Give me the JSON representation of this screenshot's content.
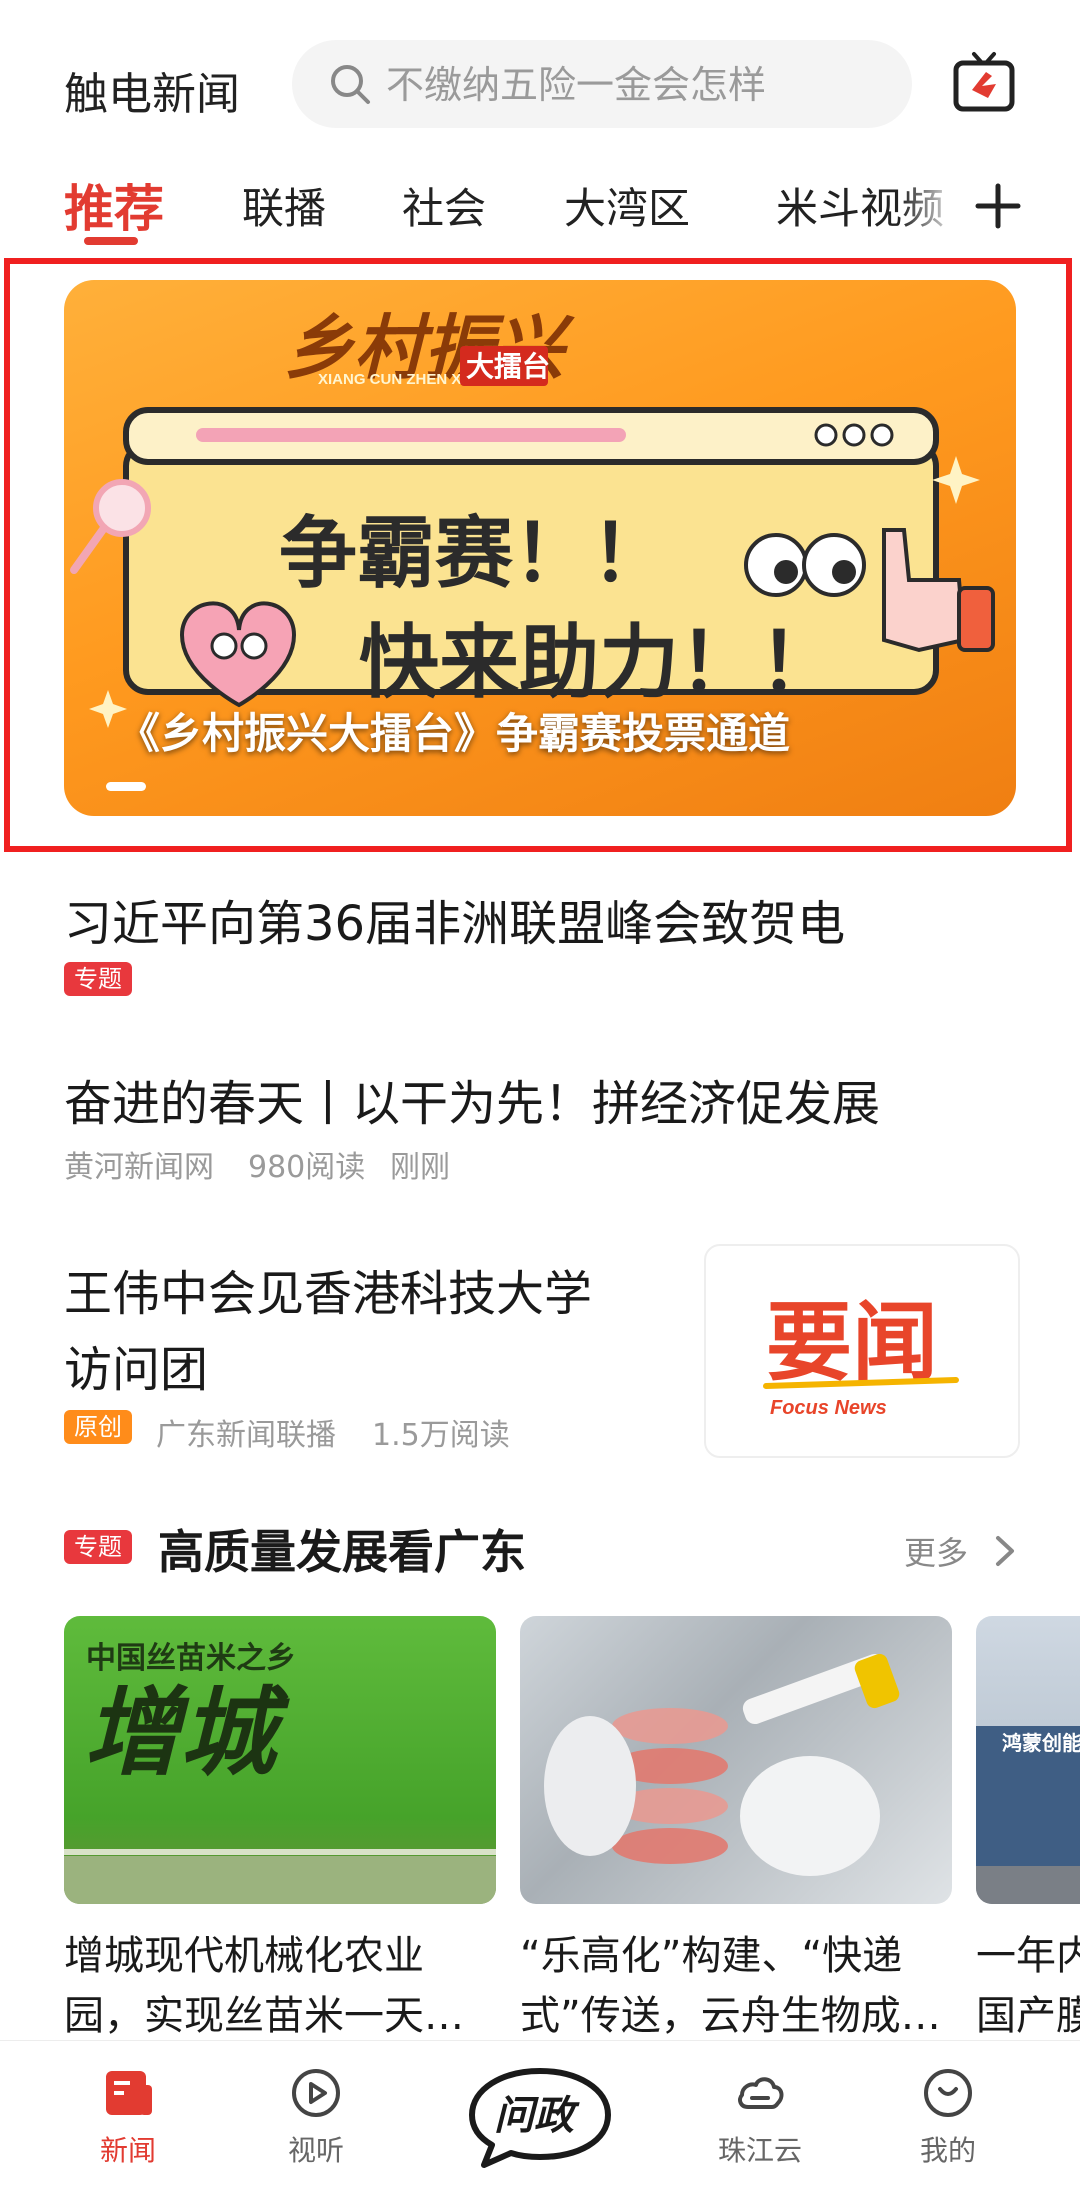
{
  "header": {
    "app_title": "触电新闻",
    "search_placeholder": "不缴纳五险一金会怎样"
  },
  "tabs": [
    {
      "label": "推荐",
      "active": true
    },
    {
      "label": "联播",
      "active": false
    },
    {
      "label": "社会",
      "active": false
    },
    {
      "label": "大湾区",
      "active": false
    },
    {
      "label": "米斗视频",
      "active": false
    }
  ],
  "banner": {
    "brand_title": "乡村振兴",
    "brand_pinyin": "XIANG CUN ZHEN XING",
    "brand_tag": "大擂台",
    "line1": "争霸赛！！",
    "line2": "快来助力！！",
    "caption": "《乡村振兴大擂台》争霸赛投票通道"
  },
  "feed": [
    {
      "title": "习近平向第36届非洲联盟峰会致贺电",
      "badge": "专题"
    },
    {
      "title": "奋进的春天丨以干为先！拼经济促发展",
      "source": "黄河新闻网",
      "reads": "980阅读",
      "time": "刚刚"
    },
    {
      "title_line1": "王伟中会见香港科技大学",
      "title_line2": "访问团",
      "badge": "原创",
      "source": "广东新闻联播",
      "reads": "1.5万阅读",
      "thumb_text": "要闻",
      "thumb_sub": "Focus News"
    }
  ],
  "topic": {
    "badge": "专题",
    "title": "高质量发展看广东",
    "more": "更多",
    "cards": [
      {
        "line1": "增城现代机械化农业",
        "line2": "园，实现丝苗米一天…",
        "image_text_top": "中国丝苗米之乡",
        "image_text_main": "增城"
      },
      {
        "line1": "“乐高化”构建、“快递",
        "line2": "式”传送，云舟生物成…"
      },
      {
        "line1": "一年内",
        "line2": "国产膜",
        "image_text": "鸿蒙创能"
      }
    ]
  },
  "bottom_nav": [
    {
      "label": "新闻",
      "active": true
    },
    {
      "label": "视听",
      "active": false
    },
    {
      "label": "问政",
      "active": false
    },
    {
      "label": "珠江云",
      "active": false
    },
    {
      "label": "我的",
      "active": false
    }
  ],
  "colors": {
    "accent": "#e23b31",
    "banner_orange": "#ff9a1f",
    "frame": "#f02020"
  }
}
